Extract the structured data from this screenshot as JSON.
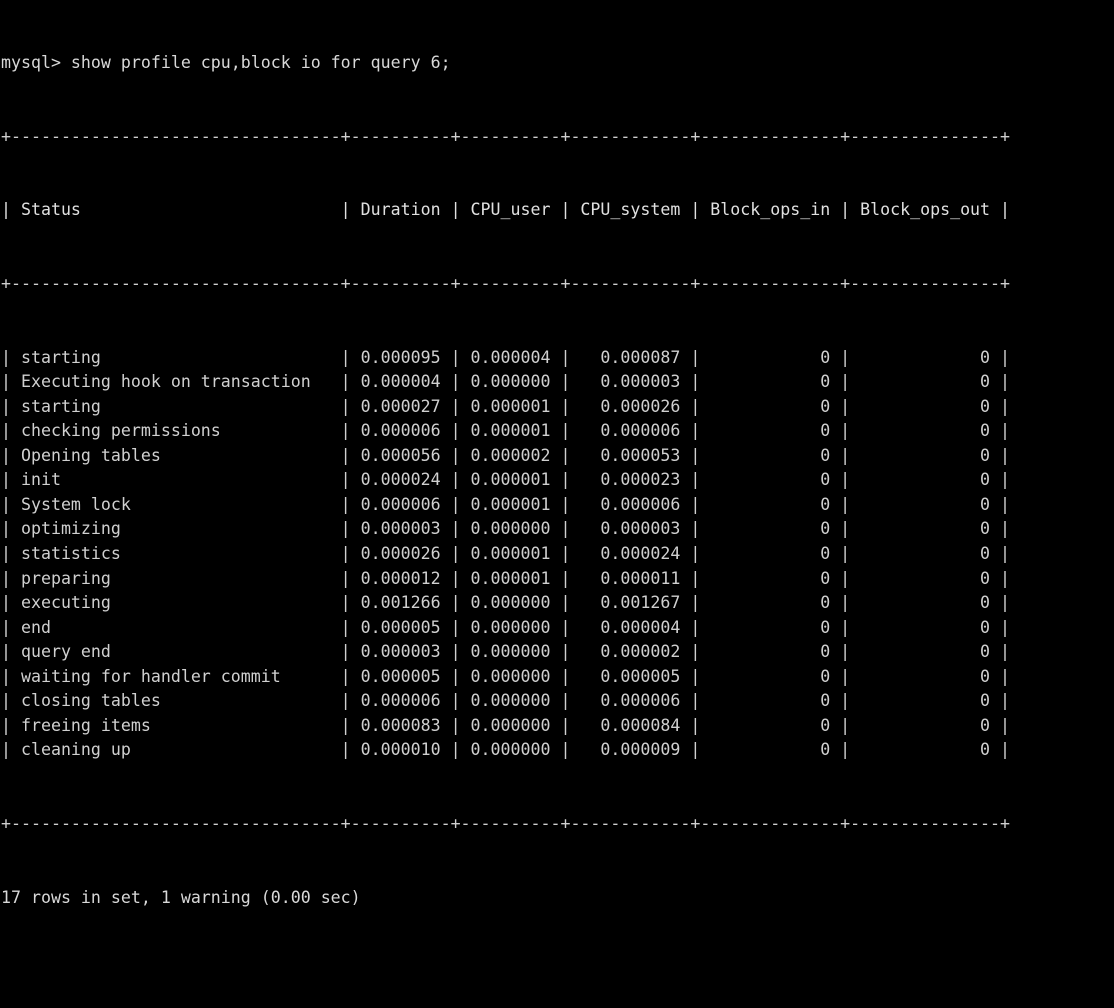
{
  "terminal": {
    "prompt": "mysql> ",
    "command": "show profile cpu,block io for query 6;",
    "prompt_line": "mysql> show profile cpu,block io for query 6;",
    "footer": "17 rows in set, 1 warning (0.00 sec)",
    "colors": {
      "background": "#000000",
      "foreground": "#d0d0d0",
      "border": "#cfcfcf"
    }
  },
  "table": {
    "columns": [
      {
        "name": "Status",
        "width": 31,
        "align": "left"
      },
      {
        "name": "Duration",
        "width": 8,
        "align": "left"
      },
      {
        "name": "CPU_user",
        "width": 8,
        "align": "left"
      },
      {
        "name": "CPU_system",
        "width": 10,
        "align": "right"
      },
      {
        "name": "Block_ops_in",
        "width": 12,
        "align": "right"
      },
      {
        "name": "Block_ops_out",
        "width": 13,
        "align": "right"
      }
    ],
    "separator": "+---------------------------------+----------+----------+------------+--------------+---------------+",
    "header_row": "| Status                          | Duration | CPU_user | CPU_system | Block_ops_in | Block_ops_out |",
    "rows": [
      {
        "status": "starting",
        "duration": "0.000095",
        "cpu_user": "0.000004",
        "cpu_system": "0.000087",
        "block_ops_in": "0",
        "block_ops_out": "0"
      },
      {
        "status": "Executing hook on transaction",
        "duration": "0.000004",
        "cpu_user": "0.000000",
        "cpu_system": "0.000003",
        "block_ops_in": "0",
        "block_ops_out": "0"
      },
      {
        "status": "starting",
        "duration": "0.000027",
        "cpu_user": "0.000001",
        "cpu_system": "0.000026",
        "block_ops_in": "0",
        "block_ops_out": "0"
      },
      {
        "status": "checking permissions",
        "duration": "0.000006",
        "cpu_user": "0.000001",
        "cpu_system": "0.000006",
        "block_ops_in": "0",
        "block_ops_out": "0"
      },
      {
        "status": "Opening tables",
        "duration": "0.000056",
        "cpu_user": "0.000002",
        "cpu_system": "0.000053",
        "block_ops_in": "0",
        "block_ops_out": "0"
      },
      {
        "status": "init",
        "duration": "0.000024",
        "cpu_user": "0.000001",
        "cpu_system": "0.000023",
        "block_ops_in": "0",
        "block_ops_out": "0"
      },
      {
        "status": "System lock",
        "duration": "0.000006",
        "cpu_user": "0.000001",
        "cpu_system": "0.000006",
        "block_ops_in": "0",
        "block_ops_out": "0"
      },
      {
        "status": "optimizing",
        "duration": "0.000003",
        "cpu_user": "0.000000",
        "cpu_system": "0.000003",
        "block_ops_in": "0",
        "block_ops_out": "0"
      },
      {
        "status": "statistics",
        "duration": "0.000026",
        "cpu_user": "0.000001",
        "cpu_system": "0.000024",
        "block_ops_in": "0",
        "block_ops_out": "0"
      },
      {
        "status": "preparing",
        "duration": "0.000012",
        "cpu_user": "0.000001",
        "cpu_system": "0.000011",
        "block_ops_in": "0",
        "block_ops_out": "0"
      },
      {
        "status": "executing",
        "duration": "0.001266",
        "cpu_user": "0.000000",
        "cpu_system": "0.001267",
        "block_ops_in": "0",
        "block_ops_out": "0"
      },
      {
        "status": "end",
        "duration": "0.000005",
        "cpu_user": "0.000000",
        "cpu_system": "0.000004",
        "block_ops_in": "0",
        "block_ops_out": "0"
      },
      {
        "status": "query end",
        "duration": "0.000003",
        "cpu_user": "0.000000",
        "cpu_system": "0.000002",
        "block_ops_in": "0",
        "block_ops_out": "0"
      },
      {
        "status": "waiting for handler commit",
        "duration": "0.000005",
        "cpu_user": "0.000000",
        "cpu_system": "0.000005",
        "block_ops_in": "0",
        "block_ops_out": "0"
      },
      {
        "status": "closing tables",
        "duration": "0.000006",
        "cpu_user": "0.000000",
        "cpu_system": "0.000006",
        "block_ops_in": "0",
        "block_ops_out": "0"
      },
      {
        "status": "freeing items",
        "duration": "0.000083",
        "cpu_user": "0.000000",
        "cpu_system": "0.000084",
        "block_ops_in": "0",
        "block_ops_out": "0"
      },
      {
        "status": "cleaning up",
        "duration": "0.000010",
        "cpu_user": "0.000000",
        "cpu_system": "0.000009",
        "block_ops_in": "0",
        "block_ops_out": "0"
      }
    ]
  }
}
